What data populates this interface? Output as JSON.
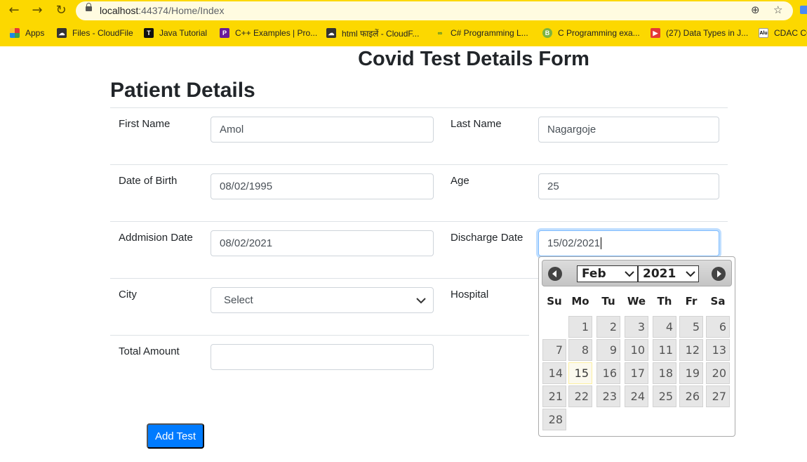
{
  "browser": {
    "url_host": "localhost",
    "url_rest": ":44374/Home/Index",
    "bookmarks": [
      {
        "label": "Apps",
        "icon": "apps-grid-icon"
      },
      {
        "label": "Files - CloudFile",
        "icon": "cloud-icon"
      },
      {
        "label": "Java Tutorial",
        "icon": "tutorial-icon"
      },
      {
        "label": "C++ Examples | Pro...",
        "icon": "programiz-icon"
      },
      {
        "label": "html फाइलें - CloudF...",
        "icon": "cloud-icon"
      },
      {
        "label": "C# Programming L...",
        "icon": "geeks-icon"
      },
      {
        "label": "C Programming exa...",
        "icon": "b-icon"
      },
      {
        "label": "(27) Data Types in J...",
        "icon": "youtube-icon"
      },
      {
        "label": "CDAC CC",
        "icon": "alu-icon"
      }
    ]
  },
  "page": {
    "title": "Covid Test Details Form",
    "section": "Patient Details"
  },
  "form": {
    "first_name": {
      "label": "First Name",
      "value": "Amol"
    },
    "last_name": {
      "label": "Last Name",
      "value": "Nagargoje"
    },
    "dob": {
      "label": "Date of Birth",
      "value": "08/02/1995"
    },
    "age": {
      "label": "Age",
      "value": "25"
    },
    "admission": {
      "label": "Addmision Date",
      "value": "08/02/2021"
    },
    "discharge": {
      "label": "Discharge Date",
      "value": "15/02/2021"
    },
    "city": {
      "label": "City",
      "value": "Select"
    },
    "hospital": {
      "label": "Hospital"
    },
    "total": {
      "label": "Total Amount",
      "value": ""
    },
    "submit_label": "Add Test"
  },
  "datepicker": {
    "month": "Feb",
    "year": "2021",
    "weekdays": [
      "Su",
      "Mo",
      "Tu",
      "We",
      "Th",
      "Fr",
      "Sa"
    ],
    "first_weekday_index": 1,
    "days": [
      "1",
      "2",
      "3",
      "4",
      "5",
      "6",
      "7",
      "8",
      "9",
      "10",
      "11",
      "12",
      "13",
      "14",
      "15",
      "16",
      "17",
      "18",
      "19",
      "20",
      "21",
      "22",
      "23",
      "24",
      "25",
      "26",
      "27",
      "28"
    ],
    "selected_day": "15"
  },
  "colors": {
    "chrome_bg": "#fcd800",
    "primary": "#007bff",
    "focus_border": "#80bdff",
    "today_bg": "#fbf9ee"
  }
}
